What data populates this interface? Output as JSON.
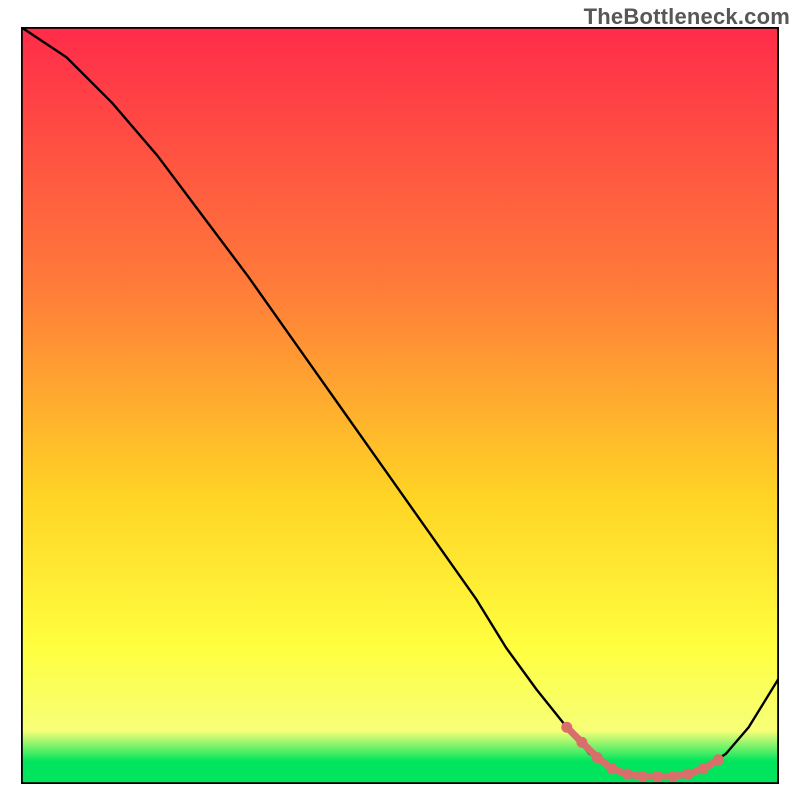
{
  "watermark": "TheBottleneck.com",
  "colors": {
    "grad_top": "#ff2b4a",
    "grad_upper_mid": "#ff7d39",
    "grad_mid": "#ffd425",
    "grad_lower_mid": "#ffff3f",
    "grad_low": "#f7ff78",
    "grad_green": "#00e55d",
    "curve": "#000000",
    "marker": "#d86f6a",
    "marker_line": "#d86f6a",
    "border": "#000000"
  },
  "chart_data": {
    "type": "line",
    "title": "",
    "xlabel": "",
    "ylabel": "",
    "xlim": [
      0,
      100
    ],
    "ylim": [
      0,
      100
    ],
    "series": [
      {
        "name": "bottleneck-curve",
        "x": [
          0,
          6,
          12,
          18,
          24,
          30,
          36,
          42,
          48,
          54,
          60,
          64,
          68,
          72,
          75,
          78,
          81,
          84,
          87,
          90,
          93,
          96,
          100
        ],
        "y": [
          100,
          96,
          90,
          83,
          75,
          67,
          58.5,
          50,
          41.5,
          33,
          24.5,
          18,
          12.5,
          7.5,
          4,
          2,
          1,
          1,
          1,
          2,
          4,
          7.5,
          14
        ]
      }
    ],
    "highlight_segment": {
      "name": "low-bottleneck-markers",
      "x": [
        72,
        74,
        76,
        78,
        80,
        82,
        84,
        86,
        88,
        90,
        92
      ],
      "y": [
        7.5,
        5.5,
        3.5,
        2,
        1.3,
        1,
        1,
        1,
        1.3,
        2,
        3.2
      ]
    },
    "gradient_bands_pct": [
      {
        "stop": 0,
        "color_key": "grad_top"
      },
      {
        "stop": 35,
        "color_key": "grad_upper_mid"
      },
      {
        "stop": 62,
        "color_key": "grad_mid"
      },
      {
        "stop": 82,
        "color_key": "grad_lower_mid"
      },
      {
        "stop": 93,
        "color_key": "grad_low"
      },
      {
        "stop": 97,
        "color_key": "grad_green"
      },
      {
        "stop": 100,
        "color_key": "grad_green"
      }
    ]
  }
}
